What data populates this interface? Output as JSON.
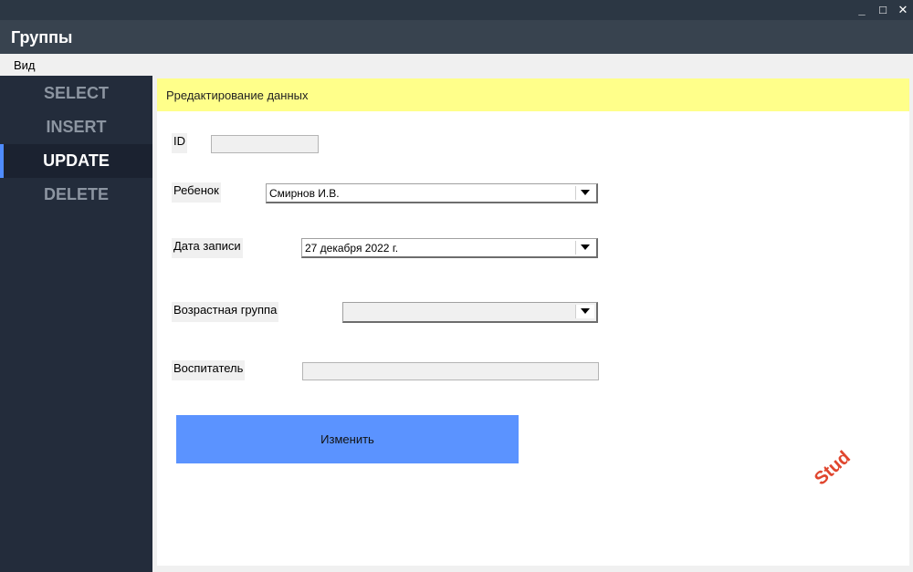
{
  "window": {
    "controls": {
      "minimize": "_",
      "maximize": "□",
      "close": "✕"
    }
  },
  "header": {
    "title": "Группы"
  },
  "menu": {
    "view": "Вид"
  },
  "sidebar": {
    "items": [
      {
        "label": "SELECT"
      },
      {
        "label": "INSERT"
      },
      {
        "label": "UPDATE"
      },
      {
        "label": "DELETE"
      }
    ],
    "active_item": "UPDATE"
  },
  "form": {
    "banner": "Рредактирование данных",
    "id": {
      "label": "ID",
      "value": ""
    },
    "child": {
      "label": "Ребенок",
      "value": "Смирнов И.В."
    },
    "date": {
      "label": "Дата записи",
      "value": "27  декабря  2022 г."
    },
    "age_group": {
      "label": "Возрастная группа",
      "value": ""
    },
    "teacher": {
      "label": "Воспитатель",
      "value": ""
    },
    "submit_label": "Изменить"
  },
  "watermark": {
    "text": "Stud"
  },
  "colors": {
    "accent": "#5b93ff",
    "sidebar_bg": "#232c3b",
    "banner_bg": "#ffff8a",
    "active_indicator": "#4f8cff"
  }
}
